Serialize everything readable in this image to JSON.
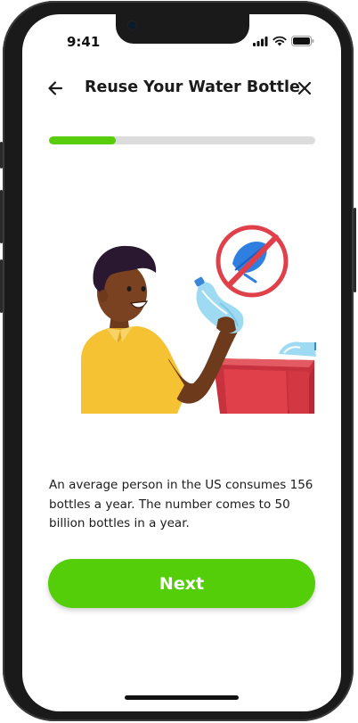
{
  "status_bar": {
    "time": "9:41",
    "icons": [
      "cellular-signal-icon",
      "wifi-icon",
      "battery-icon"
    ]
  },
  "header": {
    "title": "Reuse Your Water Bottle",
    "back_icon": "arrow-left-icon",
    "close_icon": "close-icon"
  },
  "progress": {
    "fraction": 0.25
  },
  "illustration": {
    "subject": "person holding a crushed plastic water bottle over a red recycling bin, with a no-leaf prohibition sign"
  },
  "content": {
    "body": "An average person in the US consumes 156 bottles a year. The number comes to 50 billion bottles in a year."
  },
  "actions": {
    "next_label": "Next"
  },
  "colors": {
    "accent": "#55ce0a",
    "progress_track": "#dcdcdc",
    "prohibition_red": "#e0404a",
    "bin_red": "#e0404a",
    "leaf_blue": "#2f7fe0",
    "shirt_yellow": "#f4c233"
  }
}
